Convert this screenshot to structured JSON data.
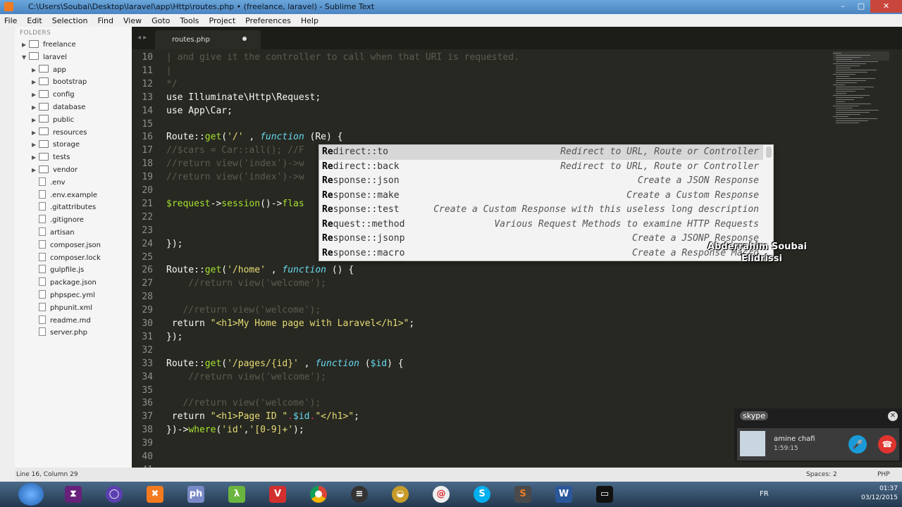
{
  "window": {
    "title": "C:\\Users\\Soubai\\Desktop\\laravel\\app\\Http\\routes.php • (freelance, laravel) - Sublime Text"
  },
  "menu": [
    "File",
    "Edit",
    "Selection",
    "Find",
    "View",
    "Goto",
    "Tools",
    "Project",
    "Preferences",
    "Help"
  ],
  "sidebar": {
    "header": "FOLDERS",
    "items": [
      {
        "label": "freelance",
        "type": "folder",
        "depth": 0,
        "expanded": false
      },
      {
        "label": "laravel",
        "type": "folder",
        "depth": 0,
        "expanded": true
      },
      {
        "label": "app",
        "type": "folder",
        "depth": 1,
        "expanded": false
      },
      {
        "label": "bootstrap",
        "type": "folder",
        "depth": 1,
        "expanded": false
      },
      {
        "label": "config",
        "type": "folder",
        "depth": 1,
        "expanded": false
      },
      {
        "label": "database",
        "type": "folder",
        "depth": 1,
        "expanded": false
      },
      {
        "label": "public",
        "type": "folder",
        "depth": 1,
        "expanded": false
      },
      {
        "label": "resources",
        "type": "folder",
        "depth": 1,
        "expanded": false
      },
      {
        "label": "storage",
        "type": "folder",
        "depth": 1,
        "expanded": false
      },
      {
        "label": "tests",
        "type": "folder",
        "depth": 1,
        "expanded": false
      },
      {
        "label": "vendor",
        "type": "folder",
        "depth": 1,
        "expanded": false
      },
      {
        "label": ".env",
        "type": "file",
        "depth": 1
      },
      {
        "label": ".env.example",
        "type": "file",
        "depth": 1
      },
      {
        "label": ".gitattributes",
        "type": "file",
        "depth": 1
      },
      {
        "label": ".gitignore",
        "type": "file",
        "depth": 1
      },
      {
        "label": "artisan",
        "type": "file",
        "depth": 1
      },
      {
        "label": "composer.json",
        "type": "file",
        "depth": 1
      },
      {
        "label": "composer.lock",
        "type": "file",
        "depth": 1
      },
      {
        "label": "gulpfile.js",
        "type": "file",
        "depth": 1
      },
      {
        "label": "package.json",
        "type": "file",
        "depth": 1
      },
      {
        "label": "phpspec.yml",
        "type": "file",
        "depth": 1
      },
      {
        "label": "phpunit.xml",
        "type": "file",
        "depth": 1
      },
      {
        "label": "readme.md",
        "type": "file",
        "depth": 1
      },
      {
        "label": "server.php",
        "type": "file",
        "depth": 1
      }
    ]
  },
  "tab": {
    "label": "routes.php",
    "nav": "◂ ▸"
  },
  "editor": {
    "lines": [
      {
        "n": "10",
        "segs": [
          [
            "cm",
            "| and give it the controller to call when that URI is requested."
          ]
        ]
      },
      {
        "n": "11",
        "segs": [
          [
            "cm",
            "|"
          ]
        ]
      },
      {
        "n": "12",
        "segs": [
          [
            "cm",
            "*/"
          ]
        ]
      },
      {
        "n": "13",
        "segs": [
          [
            "",
            "use Illuminate\\Http\\Request;"
          ]
        ]
      },
      {
        "n": "14",
        "segs": [
          [
            "",
            "use App\\Car;"
          ]
        ]
      },
      {
        "n": "15",
        "segs": []
      },
      {
        "n": "16",
        "segs": [
          [
            "",
            "Route::"
          ],
          [
            "fn",
            "get"
          ],
          [
            "",
            "("
          ],
          [
            "st",
            "'/'"
          ],
          [
            "",
            " , "
          ],
          [
            "kw",
            "function"
          ],
          [
            "",
            " (Re) {"
          ]
        ]
      },
      {
        "n": "17",
        "segs": [
          [
            "cm",
            "//$cars = Car::all(); //F"
          ]
        ]
      },
      {
        "n": "18",
        "segs": [
          [
            "cm",
            "//return view('index')->w"
          ]
        ]
      },
      {
        "n": "19",
        "segs": [
          [
            "cm",
            "//return view('index')->w"
          ]
        ]
      },
      {
        "n": "20",
        "segs": []
      },
      {
        "n": "21",
        "segs": [
          [
            "fn",
            "$request"
          ],
          [
            "",
            "->"
          ],
          [
            "fn",
            "session"
          ],
          [
            "",
            "()->"
          ],
          [
            "fn",
            "flas"
          ]
        ]
      },
      {
        "n": "22",
        "segs": []
      },
      {
        "n": "23",
        "segs": []
      },
      {
        "n": "24",
        "segs": [
          [
            "",
            "});"
          ]
        ]
      },
      {
        "n": "25",
        "segs": []
      },
      {
        "n": "26",
        "segs": [
          [
            "",
            "Route::"
          ],
          [
            "fn",
            "get"
          ],
          [
            "",
            "("
          ],
          [
            "st",
            "'/home'"
          ],
          [
            "",
            " , "
          ],
          [
            "kw",
            "function"
          ],
          [
            "",
            " () {"
          ]
        ]
      },
      {
        "n": "27",
        "segs": [
          [
            "cm",
            "    //return view('welcome');"
          ]
        ]
      },
      {
        "n": "28",
        "segs": []
      },
      {
        "n": "29",
        "segs": [
          [
            "cm",
            "   //return view('welcome');"
          ]
        ]
      },
      {
        "n": "30",
        "segs": [
          [
            "",
            " return "
          ],
          [
            "st",
            "\"<h1>My Home page with Laravel</h1>\""
          ],
          [
            "",
            ";"
          ]
        ]
      },
      {
        "n": "31",
        "segs": [
          [
            "",
            "});"
          ]
        ]
      },
      {
        "n": "32",
        "segs": []
      },
      {
        "n": "33",
        "segs": [
          [
            "",
            "Route::"
          ],
          [
            "fn",
            "get"
          ],
          [
            "",
            "("
          ],
          [
            "st",
            "'/pages/{id}'"
          ],
          [
            "",
            " , "
          ],
          [
            "kw",
            "function"
          ],
          [
            "",
            " ("
          ],
          [
            "vr",
            "$id"
          ],
          [
            "",
            ") {"
          ]
        ]
      },
      {
        "n": "34",
        "segs": [
          [
            "cm",
            "    //return view('welcome');"
          ]
        ]
      },
      {
        "n": "35",
        "segs": []
      },
      {
        "n": "36",
        "segs": [
          [
            "cm",
            "   //return view('welcome');"
          ]
        ]
      },
      {
        "n": "37",
        "segs": [
          [
            "",
            " return "
          ],
          [
            "st",
            "\"<h1>Page ID \""
          ],
          [
            "op",
            "."
          ],
          [
            "vr",
            "$id"
          ],
          [
            "op",
            "."
          ],
          [
            "st",
            "\"</h1>\""
          ],
          [
            "",
            ";"
          ]
        ]
      },
      {
        "n": "38",
        "segs": [
          [
            "",
            "})->"
          ],
          [
            "fn",
            "where"
          ],
          [
            "",
            "("
          ],
          [
            "st",
            "'id'"
          ],
          [
            "",
            ","
          ],
          [
            "st",
            "'[0-9]+'"
          ],
          [
            "",
            ");"
          ]
        ]
      },
      {
        "n": "39",
        "segs": []
      },
      {
        "n": "40",
        "segs": []
      },
      {
        "n": "41",
        "segs": []
      }
    ]
  },
  "autocomplete": {
    "items": [
      {
        "match": "Re",
        "rest": "direct::to",
        "desc": "Redirect to URL, Route or Controller",
        "selected": true
      },
      {
        "match": "Re",
        "rest": "direct::back",
        "desc": "Redirect to URL, Route or Controller"
      },
      {
        "match": "Re",
        "rest": "sponse::json",
        "desc": "Create a JSON Response"
      },
      {
        "match": "Re",
        "rest": "sponse::make",
        "desc": "Create a Custom Response"
      },
      {
        "match": "Re",
        "rest": "sponse::test",
        "desc": "Create a Custom Response with this useless long description"
      },
      {
        "match": "Re",
        "rest": "quest::method",
        "desc": "Various Request Methods to examine HTTP Requests"
      },
      {
        "match": "Re",
        "rest": "sponse::jsonp",
        "desc": "Create a JSONP Response"
      },
      {
        "match": "Re",
        "rest": "sponse::macro",
        "desc": "Create a Response Macro"
      }
    ]
  },
  "watermark": {
    "line1": "Abderrahim Soubai",
    "line2": "Elidrissi"
  },
  "skype": {
    "logo": "skype",
    "caller": "amine chafi",
    "duration": "1:59:15"
  },
  "status": {
    "position": "Line 16, Column 29",
    "spaces": "Spaces: 2",
    "syntax": "PHP"
  },
  "tray": {
    "lang": "FR",
    "time": "01:37",
    "date": "03/12/2015"
  },
  "colors": {
    "editor_bg": "#272822",
    "string": "#e6db74",
    "function": "#a6e22e",
    "keyword": "#66d9ef",
    "operator": "#f92672",
    "comment": "#5b5c50"
  }
}
